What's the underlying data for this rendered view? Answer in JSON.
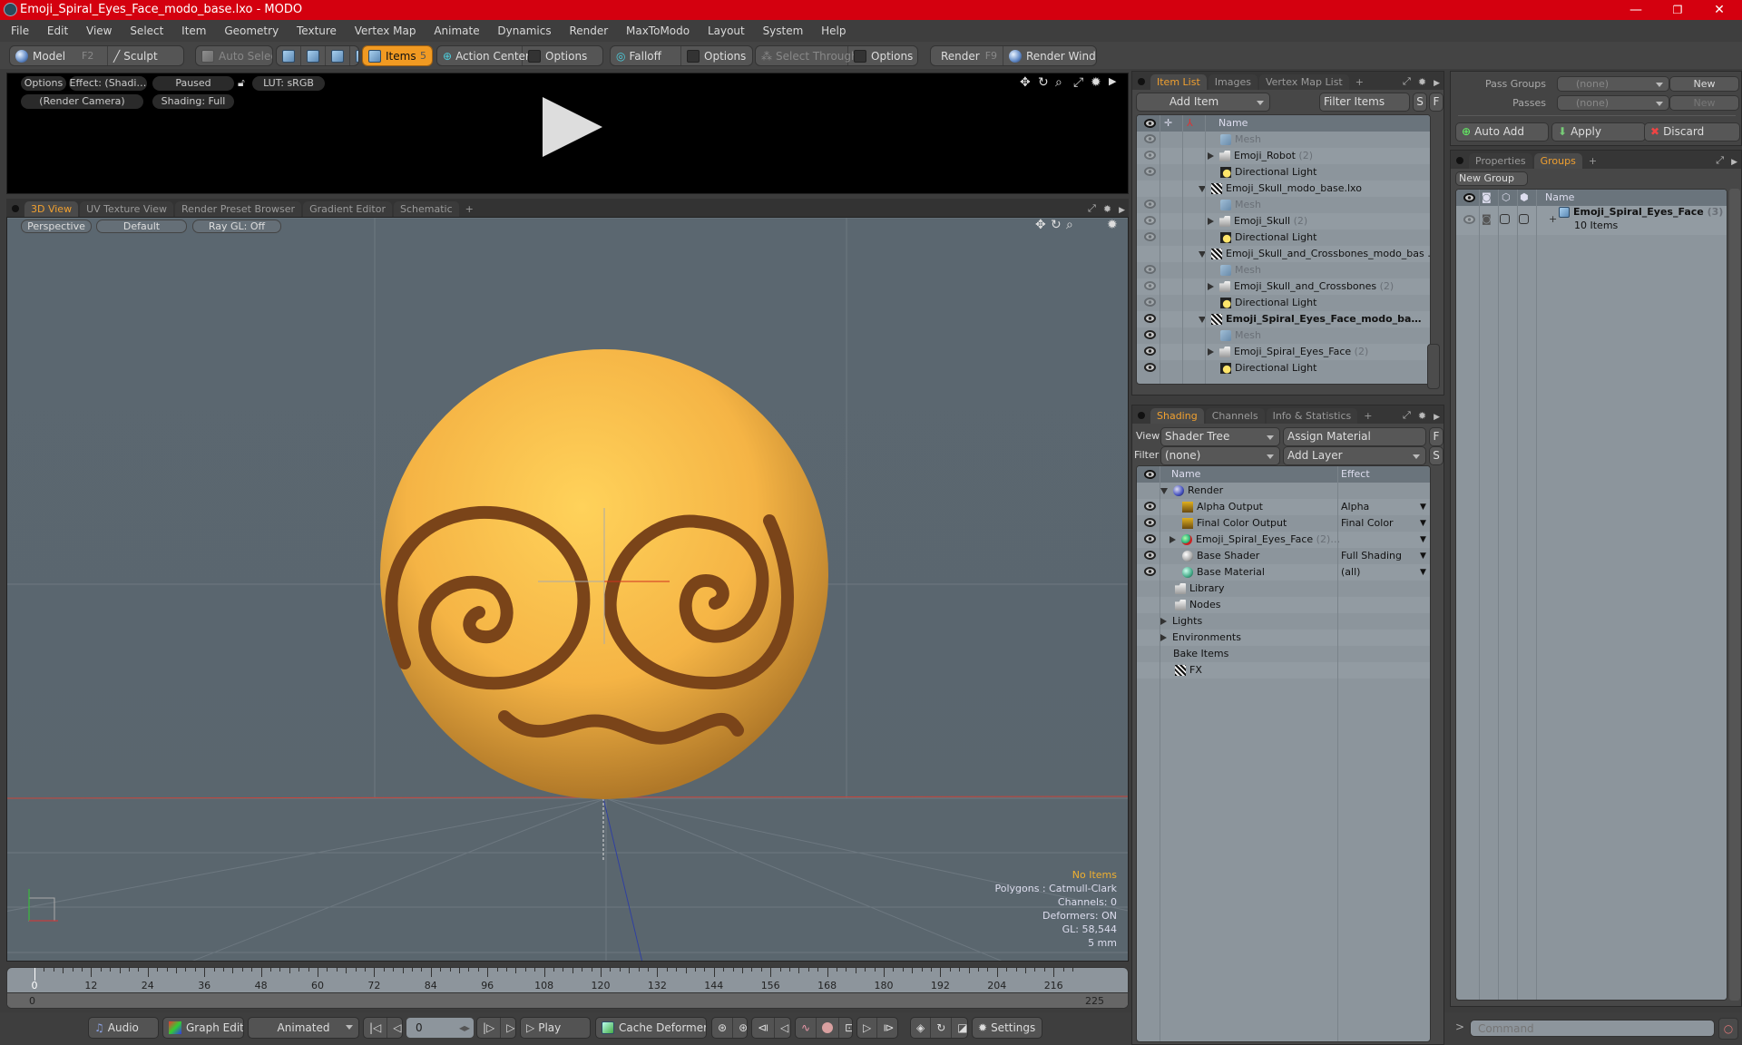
{
  "window": {
    "title": "Emoji_Spiral_Eyes_Face_modo_base.lxo - MODO",
    "controls": {
      "minimize": "—",
      "maximize": "❐",
      "close": "✕"
    }
  },
  "menu": [
    "File",
    "Edit",
    "View",
    "Select",
    "Item",
    "Geometry",
    "Texture",
    "Vertex Map",
    "Animate",
    "Dynamics",
    "Render",
    "MaxToModo",
    "Layout",
    "System",
    "Help"
  ],
  "toolbar": {
    "model": "Model",
    "model_key": "F2",
    "sculpt": "Sculpt",
    "auto_select": "Auto Select",
    "items": "Items",
    "items_key": "5",
    "action_center": "Action Center",
    "options1": "Options",
    "falloff": "Falloff",
    "options2": "Options",
    "select_through": "Select Through",
    "options3": "Options",
    "render": "Render",
    "render_key": "F9",
    "render_window": "Render Window"
  },
  "render_preview": {
    "options": "Options",
    "effect": "Effect: (Shadi…",
    "status": "Paused",
    "lut": "LUT: sRGB",
    "camera": "(Render Camera)",
    "shading": "Shading: Full"
  },
  "viewport_tabs": [
    "3D View",
    "UV Texture View",
    "Render Preset Browser",
    "Gradient Editor",
    "Schematic"
  ],
  "viewport": {
    "projection": "Perspective",
    "style": "Default",
    "raygl": "Ray GL: Off",
    "hud": {
      "selection": "No Items",
      "polygons": "Polygons : Catmull-Clark",
      "channels": "Channels: 0",
      "deformers": "Deformers: ON",
      "gl": "GL: 58,544",
      "grid": "5 mm"
    }
  },
  "timeline": {
    "ticks": [
      0,
      12,
      24,
      36,
      48,
      60,
      72,
      84,
      96,
      108,
      120,
      132,
      144,
      156,
      168,
      180,
      192,
      204,
      216
    ],
    "start": "0",
    "end": "225",
    "current": 0
  },
  "bottom": {
    "audio": "Audio",
    "graph_editor": "Graph Editor",
    "animated": "Animated",
    "frame": "0",
    "play": "Play",
    "cache_deformers": "Cache Deformers",
    "settings": "Settings"
  },
  "item_list": {
    "tabs": [
      "Item List",
      "Images",
      "Vertex Map List"
    ],
    "add_item": "Add Item",
    "filter": "Filter Items",
    "s": "S",
    "f": "F",
    "col_name": "Name",
    "rows": [
      {
        "name": "Mesh",
        "type": "mesh",
        "indent": 2,
        "eye": "dim"
      },
      {
        "name": "Emoji_Robot",
        "count": "(2)",
        "type": "folder",
        "indent": 2,
        "eye": "dim",
        "expand": "right"
      },
      {
        "name": "Directional Light",
        "type": "light",
        "indent": 2,
        "eye": "dim"
      },
      {
        "name": "Emoji_Skull_modo_base.lxo",
        "type": "scene",
        "indent": 1,
        "eye": "none",
        "expand": "down"
      },
      {
        "name": "Mesh",
        "type": "mesh",
        "indent": 2,
        "eye": "dim"
      },
      {
        "name": "Emoji_Skull",
        "count": "(2)",
        "type": "folder",
        "indent": 2,
        "eye": "dim",
        "expand": "right"
      },
      {
        "name": "Directional Light",
        "type": "light",
        "indent": 2,
        "eye": "dim"
      },
      {
        "name": "Emoji_Skull_and_Crossbones_modo_bas …",
        "type": "scene",
        "indent": 1,
        "eye": "none",
        "expand": "down"
      },
      {
        "name": "Mesh",
        "type": "mesh",
        "indent": 2,
        "eye": "dim"
      },
      {
        "name": "Emoji_Skull_and_Crossbones",
        "count": "(2)",
        "type": "folder",
        "indent": 2,
        "eye": "dim",
        "expand": "right"
      },
      {
        "name": "Directional Light",
        "type": "light",
        "indent": 2,
        "eye": "dim"
      },
      {
        "name": "Emoji_Spiral_Eyes_Face_modo_ba…",
        "type": "scene",
        "indent": 1,
        "eye": "on",
        "expand": "down",
        "bold": true
      },
      {
        "name": "Mesh",
        "type": "mesh",
        "indent": 2,
        "eye": "on"
      },
      {
        "name": "Emoji_Spiral_Eyes_Face",
        "count": "(2)",
        "type": "folder",
        "indent": 2,
        "eye": "on",
        "expand": "right"
      },
      {
        "name": "Directional Light",
        "type": "light",
        "indent": 2,
        "eye": "on"
      }
    ]
  },
  "shading": {
    "tabs": [
      "Shading",
      "Channels",
      "Info & Statistics"
    ],
    "view_label": "View",
    "view_value": "Shader Tree",
    "assign_material": "Assign Material",
    "f": "F",
    "filter_label": "Filter",
    "filter_value": "(none)",
    "add_layer": "Add Layer",
    "s": "S",
    "col_name": "Name",
    "col_effect": "Effect",
    "rows": [
      {
        "name": "Render",
        "effect": "",
        "icon": "render",
        "indent": 1,
        "eye": false,
        "expand": "down"
      },
      {
        "name": "Alpha Output",
        "effect": "Alpha",
        "icon": "output",
        "indent": 2,
        "eye": true
      },
      {
        "name": "Final Color Output",
        "effect": "Final Color",
        "icon": "output",
        "indent": 2,
        "eye": true
      },
      {
        "name": "Emoji_Spiral_Eyes_Face",
        "count": "(2)…",
        "effect": "",
        "icon": "mask",
        "indent": 2,
        "eye": true,
        "expand": "right"
      },
      {
        "name": "Base Shader",
        "effect": "Full Shading",
        "icon": "shader",
        "indent": 2,
        "eye": true
      },
      {
        "name": "Base Material",
        "effect": "(all)",
        "icon": "material",
        "indent": 2,
        "eye": true
      },
      {
        "name": "Library",
        "icon": "folder",
        "indent": 1,
        "eye": false
      },
      {
        "name": "Nodes",
        "icon": "folder",
        "indent": 1,
        "eye": false
      },
      {
        "name": "Lights",
        "icon": "none",
        "indent": 0,
        "eye": false,
        "expand": "right"
      },
      {
        "name": "Environments",
        "icon": "none",
        "indent": 0,
        "eye": false,
        "expand": "right"
      },
      {
        "name": "Bake Items",
        "icon": "none",
        "indent": 0,
        "eye": false
      },
      {
        "name": "FX",
        "icon": "scene",
        "indent": 1,
        "eye": false
      }
    ]
  },
  "passes": {
    "pass_groups_label": "Pass Groups",
    "pass_groups_value": "(none)",
    "new1": "New",
    "passes_label": "Passes",
    "passes_value": "(none)",
    "new2": "New",
    "auto_add": "Auto Add",
    "apply": "Apply",
    "discard": "Discard"
  },
  "groups": {
    "tabs": [
      "Properties",
      "Groups"
    ],
    "new_group": "New Group",
    "col_name": "Name",
    "rows": [
      {
        "name": "Emoji_Spiral_Eyes_Face",
        "count": "(3)",
        "sub": "10 Items"
      }
    ]
  },
  "command": {
    "prompt": ">",
    "placeholder": "Command"
  }
}
